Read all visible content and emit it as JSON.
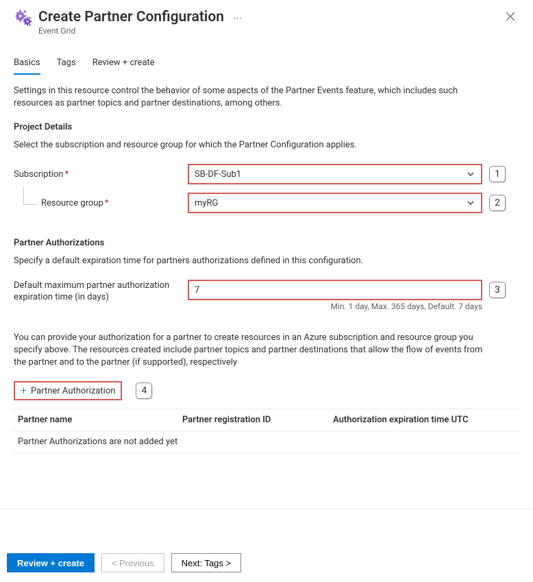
{
  "header": {
    "title": "Create Partner Configuration",
    "subtitle": "Event Grid"
  },
  "tabs": {
    "basics": "Basics",
    "tags": "Tags",
    "review": "Review + create"
  },
  "intro": "Settings in this resource control the behavior of some aspects of the Partner Events feature, which includes such resources as partner topics and partner destinations, among others.",
  "project": {
    "heading": "Project Details",
    "description": "Select the subscription and resource group for which the Partner Configuration applies.",
    "subscription_label": "Subscription",
    "subscription_value": "SB-DF-Sub1",
    "rg_label": "Resource group",
    "rg_value": "myRG"
  },
  "auth": {
    "heading": "Partner Authorizations",
    "description": "Specify a default expiration time for partners authorizations defined in this configuration.",
    "exp_label": "Default maximum partner authorization expiration time (in days)",
    "exp_value": "7",
    "exp_helper": "Min. 1 day, Max. 365 days, Default. 7 days",
    "auth_intro": "You can provide your authorization for a partner to create resources in an Azure subscription and resource group you specify above. The resources created include partner topics and partner destinations that allow the flow of events from the partner and to the partner (if supported), respectively",
    "add_button": "Partner Authorization",
    "columns": {
      "c1": "Partner name",
      "c2": "Partner registration ID",
      "c3": "Authorization expiration time UTC"
    },
    "empty": "Partner Authorizations are not added yet"
  },
  "callouts": {
    "one": "1",
    "two": "2",
    "three": "3",
    "four": "4"
  },
  "footer": {
    "review": "Review + create",
    "previous": "< Previous",
    "next": "Next: Tags >"
  }
}
